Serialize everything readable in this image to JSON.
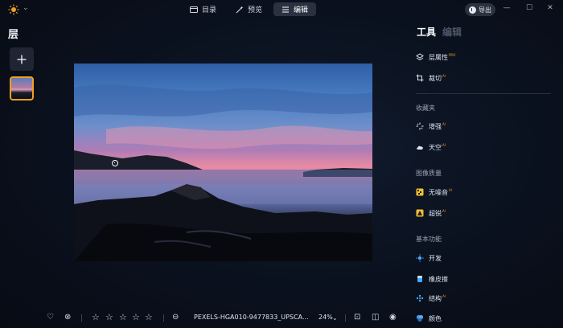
{
  "topbar": {
    "modes": [
      {
        "label": "目录",
        "icon": "folder-icon"
      },
      {
        "label": "预览",
        "icon": "magic-wand-icon"
      },
      {
        "label": "编辑",
        "icon": "sliders-icon",
        "active": true
      }
    ],
    "export_label": "导出"
  },
  "layers": {
    "title": "层"
  },
  "tools": {
    "tabs": [
      "工具",
      "编辑"
    ],
    "top_items": [
      {
        "label": "层属性",
        "badge": "PRO",
        "icon": "layers-icon"
      },
      {
        "label": "裁切",
        "badge": "AI",
        "icon": "crop-icon"
      }
    ],
    "sections": [
      {
        "title": "收藏夹",
        "items": [
          {
            "label": "增强",
            "badge": "AI",
            "icon": "sparkle-icon"
          },
          {
            "label": "天空",
            "badge": "AI",
            "icon": "cloud-icon"
          }
        ]
      },
      {
        "title": "图像质量",
        "items": [
          {
            "label": "无噪音",
            "badge": "AI",
            "icon": "denoise-icon"
          },
          {
            "label": "超锐",
            "badge": "AI",
            "icon": "sharpen-icon"
          }
        ]
      },
      {
        "title": "基本功能",
        "items": [
          {
            "label": "开发",
            "icon": "sun-icon"
          },
          {
            "label": "橡皮擦",
            "icon": "eraser-icon"
          },
          {
            "label": "结构",
            "badge": "AI",
            "icon": "structure-icon"
          },
          {
            "label": "颜色",
            "icon": "color-icon"
          }
        ]
      }
    ]
  },
  "bottom": {
    "filename": "PEXELS-HGA010-9477833_UPSCA...",
    "zoom": "24%",
    "rating": 0,
    "stars": 5
  },
  "colors": {
    "accent": "#f0a020",
    "background": "#0b1220",
    "active_tab_bg": "#2a3140"
  }
}
